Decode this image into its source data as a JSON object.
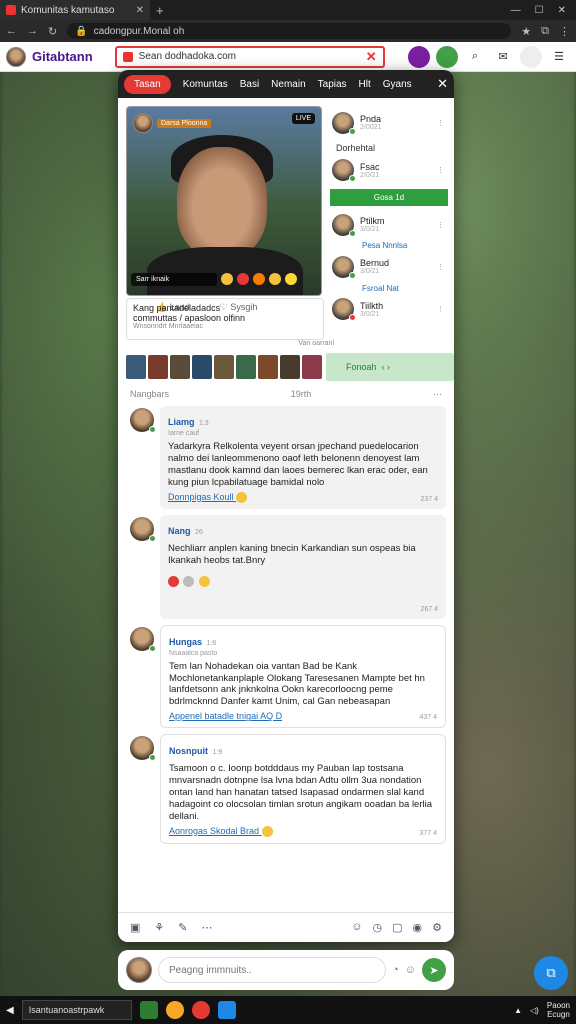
{
  "browser": {
    "tab_title": "Komunitas kamutaso",
    "url": "cadongpur.Monal oh"
  },
  "app": {
    "brand": "Gitabtann",
    "search_value": "Sean dodhadoka.com"
  },
  "categories": [
    "Tasan",
    "Komuntas",
    "Basi",
    "Nemain",
    "Tapias",
    "Hlt",
    "Gyans"
  ],
  "video": {
    "tag": "Darsa Ploonna",
    "live": "LIVE",
    "stat": "Sarr iknaik",
    "like_label": "Land",
    "share_label": "Sysgih"
  },
  "post_card": {
    "title": "Kang pantadeladadcs",
    "subtitle": "commuttas / apasloon olfinn",
    "meta": "Wnsonndrt Mnrlaaeiac",
    "caption": "Van oarranl"
  },
  "right_list": {
    "items": [
      {
        "name": "Pnda",
        "time": "2/0021"
      },
      {
        "name": "Fsac",
        "time": "2/0/21"
      },
      {
        "name": "Ptilkm",
        "time": "3/0/21"
      },
      {
        "name": "Bernud",
        "time": "3/0/21"
      },
      {
        "name": "Tiilkth",
        "time": "3/0/21"
      }
    ],
    "header": "Dorhehtal",
    "green_button": "Gosa 1d",
    "link1": "Pesa Nnnlsa",
    "link2": "Fsroal Nat",
    "pill": "Fonoah"
  },
  "section": {
    "left": "Nangbars",
    "right": "19rth"
  },
  "comments": [
    {
      "name": "Liamg",
      "meta": "Iarne cauf",
      "time": "1:3",
      "text": "Yadarkyra Relkolenta veyent orsan jpechand puedelocarion nalmo dei lanleommenono oaof leth belonenn denoyest lam mastlanu dook kamnd dan laoes bemerec lkan erac oder, ean kung piun lcpabilatuage bamidal nolo",
      "link": "Donnpigas Koull",
      "count": "237 4"
    },
    {
      "name": "Nang",
      "meta": "",
      "time": "26",
      "text": "Nechliarr anplen kaning bnecin Karkandian sun ospeas bia Ikankah heobs tat.Bnry",
      "link": "",
      "count": "267 4"
    },
    {
      "name": "Hungas",
      "meta": "Nsaaalca pasto",
      "time": "1:8",
      "text": "Tem lan Nohadekan oia vantan Bad be Kank Mochlonetankanplaple Olokang Taresesanen Mampte bet hn lanfdetsonn ank jnknkolna Ookn karecorloocng peme bdrlmcknnd Danfer kamt Unim, cal Gan nebeasapan",
      "link": "Appenel batadle tnigai AQ D",
      "count": "437 4"
    },
    {
      "name": "Nosnpuit",
      "meta": "",
      "time": "1:9",
      "text": "Tsamoon o c. Ioonp botdddaus my Pauban lap tostsana mnvarsnadn dotnpne lsa lvna bdan Adtu ollm 3ua nondation ontan land han hanatan tatsed Isapasad ondarmen slal kand hadagoint co olocsolan timlan srotun angikam ooadan ba lerlia dellani.",
      "link": "Aonrogas Skodal Brad",
      "count": "377 4"
    }
  ],
  "composer": {
    "placeholder": "Peagng immnuits.."
  },
  "taskbar": {
    "search": "Isantuanoastrpawk",
    "time": "Paoon",
    "date": "Ecugn"
  },
  "colors": {
    "accent": "#e53935",
    "green": "#43a047",
    "link": "#1e6bb8"
  }
}
